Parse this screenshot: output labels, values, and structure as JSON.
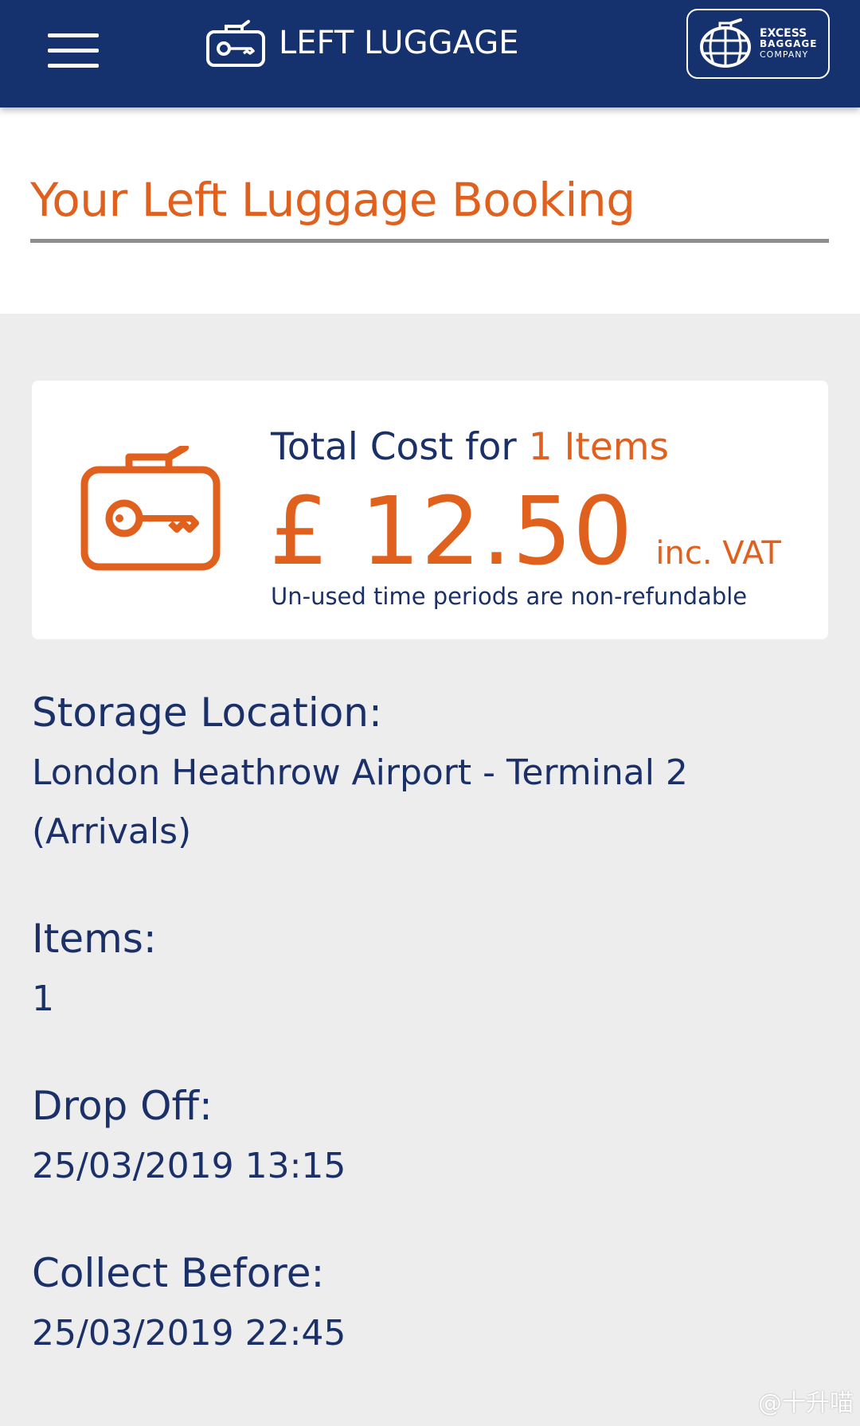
{
  "header": {
    "brand_name": "LEFT LUGGAGE",
    "partner": {
      "line1": "EXCESS",
      "line2": "BAGGAGE",
      "line3": "COMPANY"
    },
    "icons": {
      "menu": "hamburger-menu-icon",
      "brand": "luggage-key-icon",
      "partner": "globe-suitcase-icon"
    }
  },
  "page": {
    "title": "Your Left Luggage Booking"
  },
  "cost": {
    "prefix": "Total Cost for ",
    "count_text": "1 Items",
    "price": "£ 12.50",
    "vat": "inc. VAT",
    "note": "Un-used time periods are non-refundable",
    "icon": "luggage-key-icon"
  },
  "details": {
    "location_label": "Storage Location:",
    "location_value": "London Heathrow Airport - Terminal 2 (Arrivals)",
    "items_label": "Items:",
    "items_value": "1",
    "dropoff_label": "Drop Off:",
    "dropoff_value": "25/03/2019 13:15",
    "collect_label": "Collect Before:",
    "collect_value": "25/03/2019 22:45"
  },
  "watermark": "@十升喵",
  "colors": {
    "navy": "#15326f",
    "accent_orange": "#e0601e",
    "text_navy": "#1b3068",
    "background": "#ededee"
  }
}
